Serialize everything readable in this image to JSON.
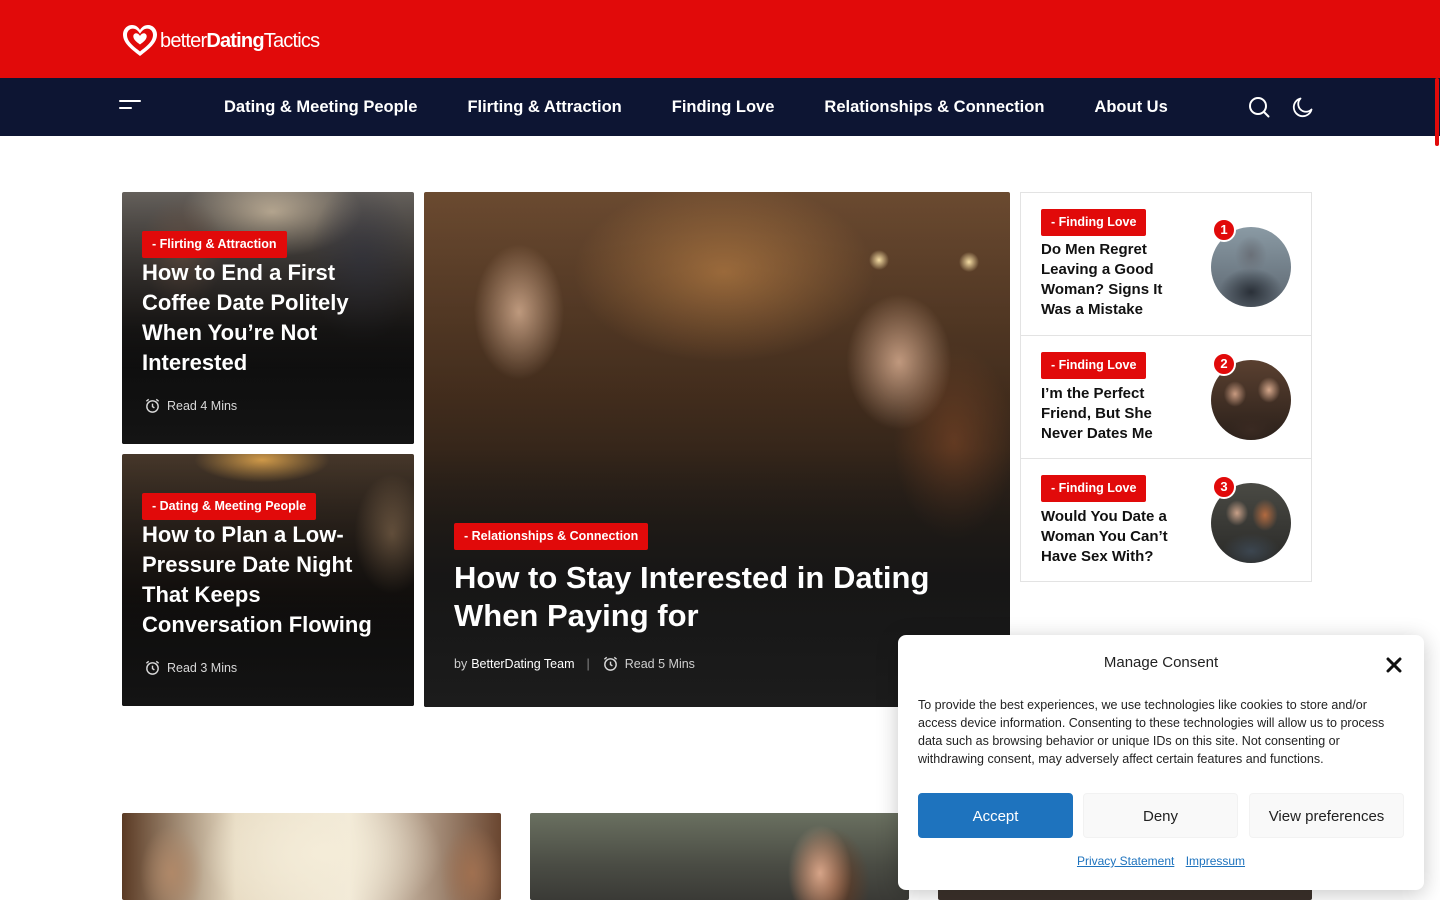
{
  "brand": {
    "logo_light": "better",
    "logo_bold": "Dating",
    "logo_tail": "Tactics",
    "accent": "#e10a0a",
    "nav_bg": "#0d1533"
  },
  "nav": {
    "items": [
      {
        "label": "Dating & Meeting People"
      },
      {
        "label": "Flirting & Attraction"
      },
      {
        "label": "Finding Love"
      },
      {
        "label": "Relationships & Connection"
      },
      {
        "label": "About Us"
      }
    ],
    "icons": [
      "menu-icon",
      "search-icon",
      "dark-mode-moon-icon"
    ]
  },
  "featured": {
    "left_top": {
      "category": "- Flirting & Attraction",
      "title": "How to End a First Coffee Date Politely When You’re Not Interested",
      "read_time": "Read 4 Mins"
    },
    "left_bottom": {
      "category": "- Dating & Meeting People",
      "title": "How to Plan a Low-Pressure Date Night That Keeps Conversation Flowing",
      "read_time": "Read 3 Mins"
    },
    "main": {
      "category": "- Relationships & Connection",
      "title": "How to Stay Interested in Dating When Paying for",
      "author_prefix": "by",
      "author": "BetterDating Team",
      "read_time": "Read 5 Mins"
    }
  },
  "trending": [
    {
      "rank": "1",
      "category": "- Finding Love",
      "title": "Do Men Regret Leaving a Good Woman? Signs It Was a Mistake"
    },
    {
      "rank": "2",
      "category": "- Finding Love",
      "title": "I’m the Perfect Friend, But She Never Dates Me"
    },
    {
      "rank": "3",
      "category": "- Finding Love",
      "title": "Would You Date a Woman You Can’t Have Sex With?"
    }
  ],
  "consent": {
    "title": "Manage Consent",
    "text": "To provide the best experiences, we use technologies like cookies to store and/or access device information. Consenting to these technologies will allow us to process data such as browsing behavior or unique IDs on this site. Not consenting or withdrawing consent, may adversely affect certain features and functions.",
    "accept": "Accept",
    "deny": "Deny",
    "preferences": "View preferences",
    "privacy_link": "Privacy Statement",
    "impressum_link": "Impressum",
    "accept_color": "#1e73be"
  }
}
